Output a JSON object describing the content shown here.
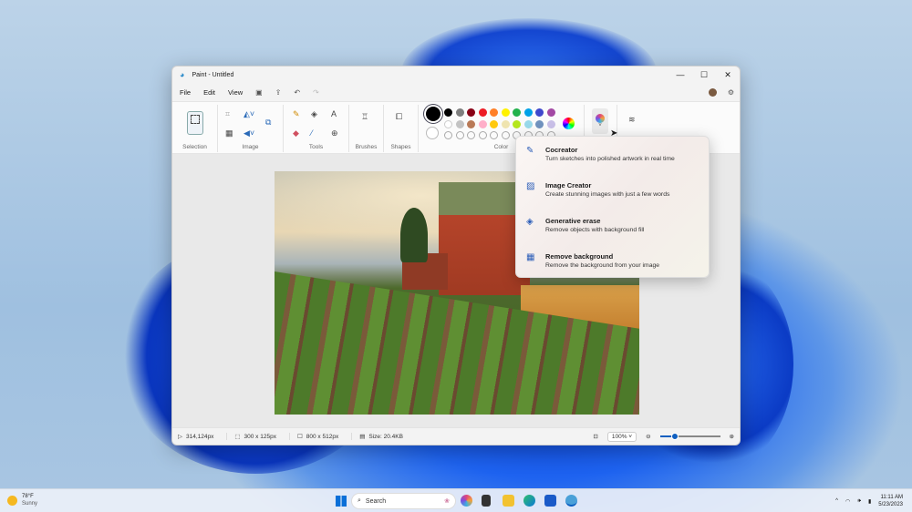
{
  "window": {
    "title": "Paint - Untitled",
    "minimize": "—",
    "maximize": "☐",
    "close": "✕"
  },
  "menu": {
    "file": "File",
    "edit": "Edit",
    "view": "View"
  },
  "ribbon": {
    "selection": "Selection",
    "image": "Image",
    "tools": "Tools",
    "brushes": "Brushes",
    "shapes": "Shapes",
    "color": "Color"
  },
  "palette": {
    "row1": [
      "#000000",
      "#7f7f7f",
      "#880015",
      "#ed1c24",
      "#ff7f27",
      "#fff200",
      "#22b14c",
      "#00a2e8",
      "#3f48cc",
      "#a349a4"
    ],
    "row2": [
      "#ffffff",
      "#c3c3c3",
      "#b97a57",
      "#ffaec9",
      "#ffc90e",
      "#efe4b0",
      "#b5e61d",
      "#99d9ea",
      "#7092be",
      "#c8bfe7"
    ],
    "primary": "#000000",
    "secondary": "#ffffff"
  },
  "ai_menu": [
    {
      "title": "Cocreator",
      "desc": "Turn sketches into polished artwork in real time",
      "icon": "cocreator-brush-icon"
    },
    {
      "title": "Image Creator",
      "desc": "Create stunning images with just a few words",
      "icon": "image-creator-icon"
    },
    {
      "title": "Generative erase",
      "desc": "Remove objects with background fill",
      "icon": "generative-erase-icon"
    },
    {
      "title": "Remove background",
      "desc": "Remove the background from your image",
      "icon": "remove-background-icon"
    }
  ],
  "status": {
    "cursor": "314,124px",
    "selection": "300 x 125px",
    "canvas": "800 x 512px",
    "size": "Size: 20.4KB",
    "zoom": "100%",
    "zoom_slider_percent": 25
  },
  "taskbar": {
    "weather_temp": "78°F",
    "weather_cond": "Sunny",
    "search": "Search",
    "time": "11:11 AM",
    "date": "5/23/2023"
  }
}
